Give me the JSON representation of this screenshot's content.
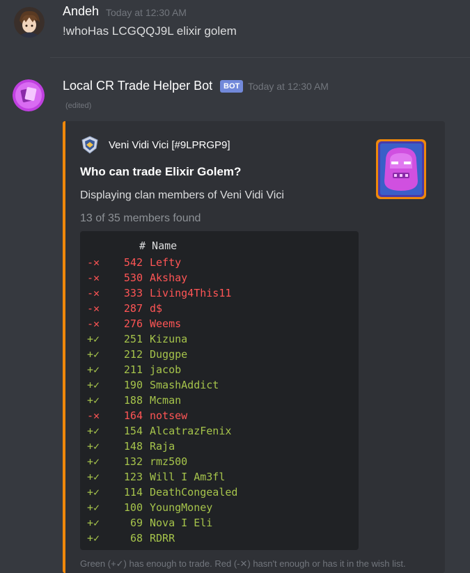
{
  "messages": {
    "user": {
      "username": "Andeh",
      "timestamp": "Today at 12:30 AM",
      "content": "!whoHas LCGQQJ9L elixir golem"
    },
    "bot": {
      "username": "Local CR Trade Helper Bot",
      "badge": "BOT",
      "timestamp": "Today at 12:30 AM",
      "edited": "(edited)",
      "embed": {
        "accent_color": "#f0880a",
        "author": "Veni Vidi Vici [#9LPRGP9]",
        "author_icon": "clan-badge-icon",
        "thumbnail": "elixir-golem-card-icon",
        "title": "Who can trade Elixir Golem?",
        "description": "Displaying clan members of Veni Vidi Vici",
        "count": "13 of 35 members found",
        "table": {
          "header": "# Name",
          "rows": [
            {
              "sign": "-✕",
              "rank": "542",
              "name": "Lefty",
              "status": "red"
            },
            {
              "sign": "-✕",
              "rank": "530",
              "name": "Akshay",
              "status": "red"
            },
            {
              "sign": "-✕",
              "rank": "333",
              "name": "Living4This11",
              "status": "red"
            },
            {
              "sign": "-✕",
              "rank": "287",
              "name": "d$",
              "status": "red"
            },
            {
              "sign": "-✕",
              "rank": "276",
              "name": "Weems",
              "status": "red"
            },
            {
              "sign": "+✓",
              "rank": "251",
              "name": "Kizuna",
              "status": "green"
            },
            {
              "sign": "+✓",
              "rank": "212",
              "name": "Duggpe",
              "status": "green"
            },
            {
              "sign": "+✓",
              "rank": "211",
              "name": "jacob",
              "status": "green"
            },
            {
              "sign": "+✓",
              "rank": "190",
              "name": "SmashAddict",
              "status": "green"
            },
            {
              "sign": "+✓",
              "rank": "188",
              "name": "Mcman",
              "status": "green"
            },
            {
              "sign": "-✕",
              "rank": "164",
              "name": "notsew",
              "status": "red"
            },
            {
              "sign": "+✓",
              "rank": "154",
              "name": "AlcatrazFenix",
              "status": "green"
            },
            {
              "sign": "+✓",
              "rank": "148",
              "name": "Raja",
              "status": "green"
            },
            {
              "sign": "+✓",
              "rank": "132",
              "name": "rmz500",
              "status": "green"
            },
            {
              "sign": "+✓",
              "rank": "123",
              "name": "Will I Am3fl",
              "status": "green"
            },
            {
              "sign": "+✓",
              "rank": "114",
              "name": "DeathCongealed",
              "status": "green"
            },
            {
              "sign": "+✓",
              "rank": "100",
              "name": "YoungMoney",
              "status": "green"
            },
            {
              "sign": "+✓",
              "rank": "69",
              "name": "Nova I Eli",
              "status": "green"
            },
            {
              "sign": "+✓",
              "rank": "68",
              "name": "RDRR",
              "status": "green"
            }
          ]
        },
        "footer": "Green (+✓) has enough to trade. Red (-✕) hasn't enough or has it in the wish list."
      }
    }
  },
  "colors": {
    "background": "#36393f",
    "embed_bg": "#2f3136",
    "code_bg": "#202225",
    "red": "#ff5555",
    "green": "#a6c44b",
    "bot_badge": "#7289da"
  }
}
